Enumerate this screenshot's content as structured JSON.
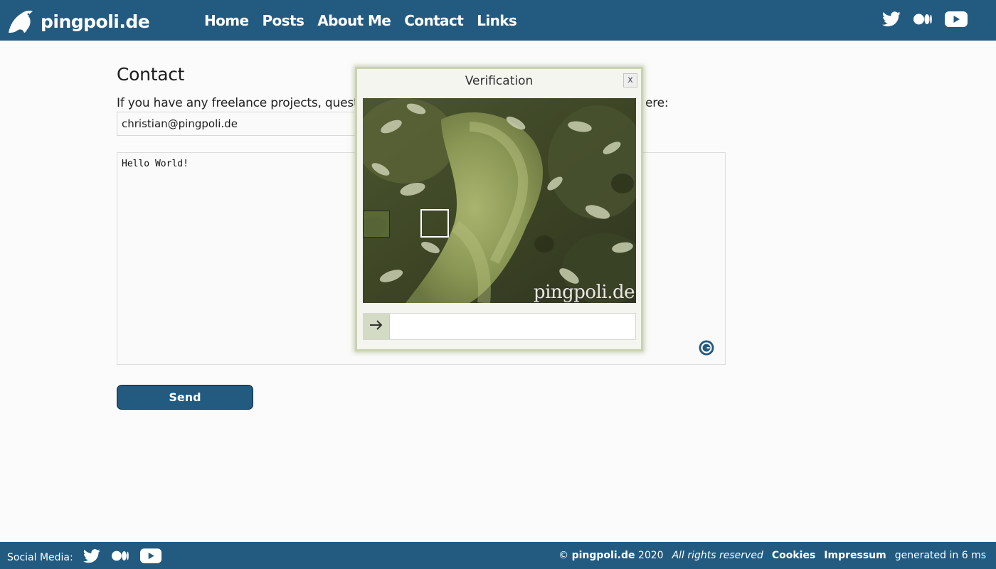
{
  "header": {
    "site_name": "pingpoli.de",
    "nav": [
      "Home",
      "Posts",
      "About Me",
      "Contact",
      "Links"
    ],
    "social_icons": [
      "twitter-icon",
      "medium-icon",
      "youtube-icon"
    ],
    "background": "#235a80"
  },
  "contact": {
    "title": "Contact",
    "intro": "If you have any freelance projects, questic",
    "intro_tail": "ere:",
    "email_value": "christian@pingpoli.de",
    "message_value": "Hello World!",
    "send_label": "Send"
  },
  "verification": {
    "title": "Verification",
    "close_label": "x",
    "watermark": "pingpoli.de",
    "arrow_icon": "arrow-right-icon",
    "answer_value": ""
  },
  "footer": {
    "social_label": "Social Media:",
    "copyright_symbol": "©",
    "copyright_name": "pingpoli.de",
    "copyright_year": "2020",
    "rights": "All rights reserved",
    "cookies": "Cookies",
    "impressum": "Impressum",
    "generated": "generated in 6 ms"
  }
}
